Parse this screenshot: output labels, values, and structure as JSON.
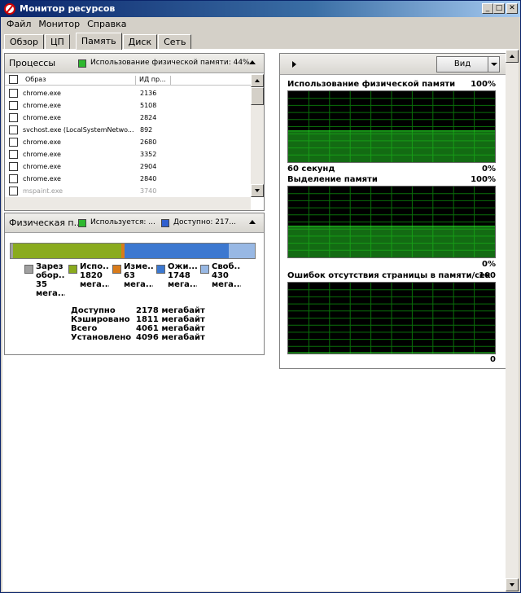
{
  "window": {
    "title": "Монитор ресурсов"
  },
  "titlebar_buttons": {
    "minimize": "_",
    "maximize": "□",
    "close": "✕"
  },
  "menu": [
    "Файл",
    "Монитор",
    "Справка"
  ],
  "tabs": [
    "Обзор",
    "ЦП",
    "Память",
    "Диск",
    "Сеть"
  ],
  "active_tab": "Память",
  "processes": {
    "title": "Процессы",
    "legend": "Использование физической памяти: 44%",
    "legend_color": "#2eb82e",
    "columns": [
      "Образ",
      "ИД пр..."
    ],
    "rows": [
      {
        "name": "chrome.exe",
        "pid": "2136"
      },
      {
        "name": "chrome.exe",
        "pid": "5108"
      },
      {
        "name": "chrome.exe",
        "pid": "2824"
      },
      {
        "name": "svchost.exe (LocalSystemNetwo...",
        "pid": "892"
      },
      {
        "name": "chrome.exe",
        "pid": "2680"
      },
      {
        "name": "chrome.exe",
        "pid": "3352"
      },
      {
        "name": "chrome.exe",
        "pid": "2904"
      },
      {
        "name": "chrome.exe",
        "pid": "2840"
      },
      {
        "name": "mspaint.exe",
        "pid": "3740"
      }
    ]
  },
  "physical_memory": {
    "title": "Физическая п...",
    "legend_used": "Используется: ...",
    "legend_used_color": "#2eb82e",
    "legend_available": "Доступно: 217...",
    "legend_available_color": "#2f5fcf",
    "bar": [
      {
        "key": "reserved",
        "mb": 35,
        "color": "#a0a0a0"
      },
      {
        "key": "used",
        "mb": 1820,
        "color": "#8aab1e"
      },
      {
        "key": "modified",
        "mb": 63,
        "color": "#d97b1a"
      },
      {
        "key": "standby",
        "mb": 1748,
        "color": "#3c78d0"
      },
      {
        "key": "free",
        "mb": 430,
        "color": "#98b8e4"
      }
    ],
    "legend_items": [
      {
        "l1": "Зарез",
        "l2": "обор...",
        "l3": "35",
        "l4": "мега...",
        "color": "#a0a0a0"
      },
      {
        "l1": "Испо...",
        "l2": "1820",
        "l3": "мега...",
        "l4": "",
        "color": "#8aab1e"
      },
      {
        "l1": "Изме...",
        "l2": "63",
        "l3": "мега...",
        "l4": "",
        "color": "#d97b1a"
      },
      {
        "l1": "Ожи...",
        "l2": "1748",
        "l3": "мега...",
        "l4": "",
        "color": "#3c78d0"
      },
      {
        "l1": "Своб...",
        "l2": "430",
        "l3": "мега...",
        "l4": "",
        "color": "#98b8e4"
      }
    ],
    "stats": [
      {
        "label": "Доступно",
        "value": "2178 мегабайт"
      },
      {
        "label": "Кэшировано",
        "value": "1811 мегабайт"
      },
      {
        "label": "Всего",
        "value": "4061 мегабайт"
      },
      {
        "label": "Установлено",
        "value": "4096 мегабайт"
      }
    ]
  },
  "view_button": "Вид",
  "charts": [
    {
      "title": "Использование физической памяти",
      "max": "100%",
      "min": "0%",
      "left_footer": "60 секунд",
      "level_percent": 44,
      "line_color": "#22c322"
    },
    {
      "title": "Выделение памяти",
      "max": "100%",
      "min": "0%",
      "left_footer": "",
      "level_percent": 44,
      "line_color": "#22c322"
    },
    {
      "title": "Ошибок отсутствия страницы в памяти/сек",
      "max": "100",
      "min": "0",
      "left_footer": "",
      "level_percent": 0,
      "line_color": "#22c322"
    }
  ]
}
